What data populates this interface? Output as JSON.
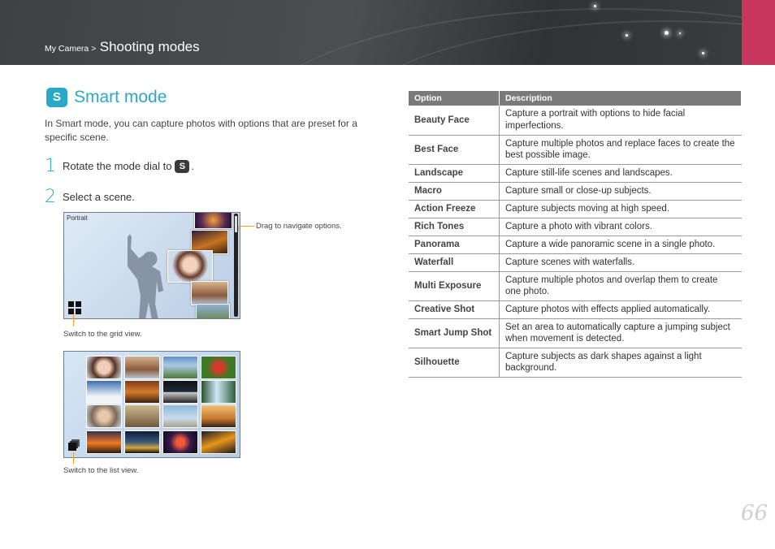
{
  "header": {
    "breadcrumb_parent": "My Camera >",
    "breadcrumb_current": "Shooting modes"
  },
  "section": {
    "badge": "S",
    "title": "Smart mode",
    "intro": "In Smart mode, you can capture photos with options that are preset for a specific scene."
  },
  "steps": [
    {
      "number": "1",
      "text": "Rotate the mode dial to",
      "icon_letter": "S",
      "suffix": "."
    },
    {
      "number": "2",
      "text": "Select a scene."
    }
  ],
  "figure1": {
    "screen_label": "Portrait",
    "callout_drag": "Drag to navigate options.",
    "callout_grid": "Switch to the grid view."
  },
  "figure2": {
    "callout_list": "Switch to the list view."
  },
  "table": {
    "headers": [
      "Option",
      "Description"
    ],
    "rows": [
      {
        "option": "Beauty Face",
        "description": "Capture a portrait with options to hide facial imperfections."
      },
      {
        "option": "Best Face",
        "description": "Capture multiple photos and replace faces to create the best possible image."
      },
      {
        "option": "Landscape",
        "description": "Capture still-life scenes and landscapes."
      },
      {
        "option": "Macro",
        "description": "Capture small or close-up subjects."
      },
      {
        "option": "Action Freeze",
        "description": "Capture subjects moving at high speed."
      },
      {
        "option": "Rich Tones",
        "description": "Capture a photo with vibrant colors."
      },
      {
        "option": "Panorama",
        "description": "Capture a wide panoramic scene in a single photo."
      },
      {
        "option": "Waterfall",
        "description": "Capture scenes with waterfalls."
      },
      {
        "option": "Multi Exposure",
        "description": "Capture multiple photos and overlap them to create one photo."
      },
      {
        "option": "Creative Shot",
        "description": "Capture photos with effects applied automatically."
      },
      {
        "option": "Smart Jump Shot",
        "description": "Set an area to automatically capture a jumping subject when movement is detected."
      },
      {
        "option": "Silhouette",
        "description": "Capture subjects as dark shapes against a light background."
      }
    ]
  },
  "page_number": "66",
  "colors": {
    "accent": "#2aa8c9",
    "pink_tab": "#c8365c",
    "callout": "#f5a21f"
  }
}
